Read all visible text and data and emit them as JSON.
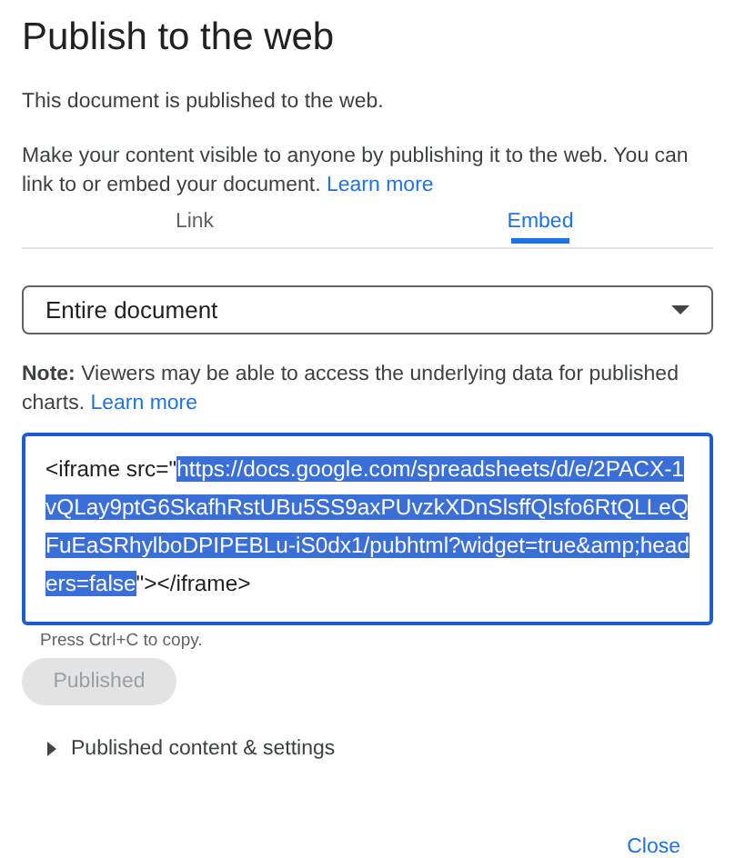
{
  "dialog": {
    "title": "Publish to the web"
  },
  "status": "This document is published to the web.",
  "description": {
    "text": "Make your content visible to anyone by publishing it to the web. You can link to or embed your document.",
    "link": "Learn more"
  },
  "tabs": [
    {
      "label": "Link",
      "selected": false
    },
    {
      "label": "Embed",
      "selected": true
    }
  ],
  "scope_dropdown": {
    "value": "Entire document"
  },
  "note": {
    "text": "**Note:** Viewers may be able to access the underlying data for published charts.",
    "link": "Learn more"
  },
  "embed_code": {
    "before": "<iframe src=\"",
    "selected_text": "https://docs.google.com/spreadsheets/d/e/2PACX-1vQLay9ptG6SkafhRstUBu5SS9axPUvzkXDnSlsffQlsfo6RtQLLeQFuEaSRhylboDPIPEBLu-iS0dx1/pubhtml?widget=true&amp;headers=false",
    "after": "\"></iframe>"
  },
  "copy_hint": "Press Ctrl+C to copy.",
  "publish_button": {
    "label": "Published",
    "disabled": true
  },
  "settings_section": {
    "label": "Published content & settings",
    "expanded": false
  },
  "close_button": "Close"
}
